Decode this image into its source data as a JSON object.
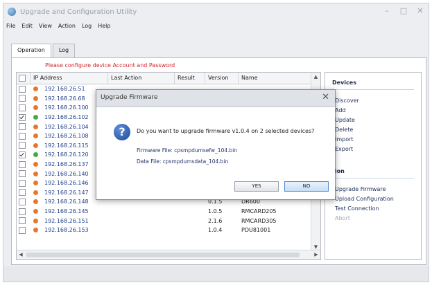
{
  "window": {
    "title": "Upgrade and Configuration Utility",
    "controls": {
      "minimize": "–",
      "maximize": "□",
      "close": "✕"
    }
  },
  "menu": [
    "File",
    "Edit",
    "View",
    "Action",
    "Log",
    "Help"
  ],
  "tabs": [
    {
      "label": "Operation",
      "active": true
    },
    {
      "label": "Log",
      "active": false
    }
  ],
  "operation": {
    "warning": "Please configure device Account and Password",
    "columns": [
      "IP Address",
      "Last Action",
      "Result",
      "Version",
      "Name"
    ],
    "rows": [
      {
        "checked": false,
        "status": "orange",
        "ip": "192.168.26.51",
        "last_action": "",
        "result": "",
        "version": "",
        "name": ""
      },
      {
        "checked": false,
        "status": "orange",
        "ip": "192.168.26.68",
        "last_action": "",
        "result": "",
        "version": "",
        "name": ""
      },
      {
        "checked": false,
        "status": "orange",
        "ip": "192.168.26.100",
        "last_action": "",
        "result": "",
        "version": "",
        "name": ""
      },
      {
        "checked": true,
        "status": "green",
        "ip": "192.168.26.102",
        "last_action": "",
        "result": "",
        "version": "",
        "name": ""
      },
      {
        "checked": false,
        "status": "orange",
        "ip": "192.168.26.104",
        "last_action": "",
        "result": "",
        "version": "",
        "name": ""
      },
      {
        "checked": false,
        "status": "orange",
        "ip": "192.168.26.108",
        "last_action": "",
        "result": "",
        "version": "",
        "name": ""
      },
      {
        "checked": false,
        "status": "orange",
        "ip": "192.168.26.115",
        "last_action": "",
        "result": "",
        "version": "",
        "name": ""
      },
      {
        "checked": true,
        "status": "green",
        "ip": "192.168.26.120",
        "last_action": "",
        "result": "",
        "version": "",
        "name": ""
      },
      {
        "checked": false,
        "status": "orange",
        "ip": "192.168.26.137",
        "last_action": "",
        "result": "",
        "version": "",
        "name": ""
      },
      {
        "checked": false,
        "status": "orange",
        "ip": "192.168.26.140",
        "last_action": "",
        "result": "",
        "version": "",
        "name": ""
      },
      {
        "checked": false,
        "status": "orange",
        "ip": "192.168.26.146",
        "last_action": "",
        "result": "",
        "version": "",
        "name": ""
      },
      {
        "checked": false,
        "status": "orange",
        "ip": "192.168.26.147",
        "last_action": "",
        "result": "",
        "version": "",
        "name": ""
      },
      {
        "checked": false,
        "status": "orange",
        "ip": "192.168.26.148",
        "last_action": "",
        "result": "",
        "version": "0.1.5",
        "name": "DR600"
      },
      {
        "checked": false,
        "status": "orange",
        "ip": "192.168.26.145",
        "last_action": "",
        "result": "",
        "version": "1.0.5",
        "name": "RMCARD205"
      },
      {
        "checked": false,
        "status": "orange",
        "ip": "192.168.26.151",
        "last_action": "",
        "result": "",
        "version": "2.1.6",
        "name": "RMCARD305"
      },
      {
        "checked": false,
        "status": "orange",
        "ip": "192.168.26.153",
        "last_action": "",
        "result": "",
        "version": "1.0.4",
        "name": "PDU81001"
      }
    ]
  },
  "side": {
    "devices_title": "Devices",
    "devices_items": [
      "Discover",
      "Add",
      "Update",
      "Delete",
      "Import",
      "Export"
    ],
    "action_title": "tion",
    "action_items": [
      {
        "label": "Upgrade Firmware",
        "enabled": true
      },
      {
        "label": "Upload Configuration",
        "enabled": true
      },
      {
        "label": "Test Connection",
        "enabled": true
      },
      {
        "label": "Abort",
        "enabled": false
      }
    ]
  },
  "dialog": {
    "title": "Upgrade Firmware",
    "close": "✕",
    "icon": "question-icon",
    "message": "Do you want to upgrade firmware v1.0.4 on 2 selected devices?",
    "firmware_file": "Firmware File: cpsmpdumsefw_104.bin",
    "data_file": "Data File: cpsmpdumsdata_104.bin",
    "yes_label": "YES",
    "no_label": "NO"
  },
  "colors": {
    "status_orange": "#e8772a",
    "status_green": "#3fae3c",
    "warning": "#d1252b",
    "accent": "#4d8ccc"
  }
}
